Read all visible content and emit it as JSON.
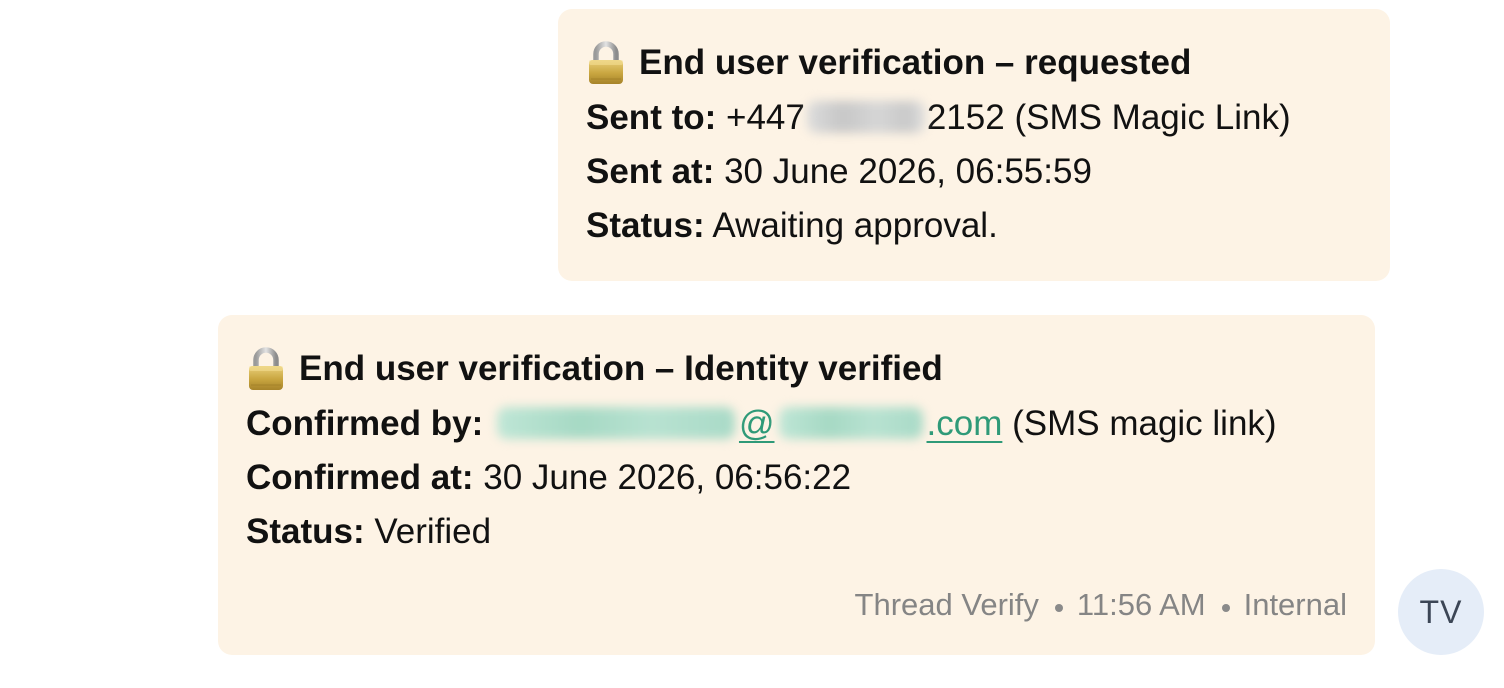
{
  "messages": [
    {
      "title": "End user verification – requested",
      "icon": "lock-icon",
      "sent_to_label": "Sent to:",
      "phone_prefix": "+447",
      "phone_suffix": "2152",
      "method": "(SMS Magic Link)",
      "sent_at_label": "Sent at:",
      "sent_at_value": "30 June 2026, 06:55:59",
      "status_label": "Status:",
      "status_value": "Awaiting approval."
    },
    {
      "title": "End user verification – Identity verified",
      "icon": "lock-icon",
      "confirmed_by_label": "Confirmed by:",
      "email_at": "@",
      "email_tld": ".com",
      "method": "(SMS magic link)",
      "confirmed_at_label": "Confirmed at:",
      "confirmed_at_value": "30 June 2026, 06:56:22",
      "status_label": "Status:",
      "status_value": "Verified",
      "meta": {
        "sender": "Thread Verify",
        "time": "11:56 AM",
        "visibility": "Internal"
      }
    }
  ],
  "avatar": {
    "initials": "TV"
  },
  "colors": {
    "bubble_bg": "#fdf3e5",
    "link": "#2f9a78",
    "meta_text": "#858585",
    "avatar_bg": "#e5edf8"
  }
}
